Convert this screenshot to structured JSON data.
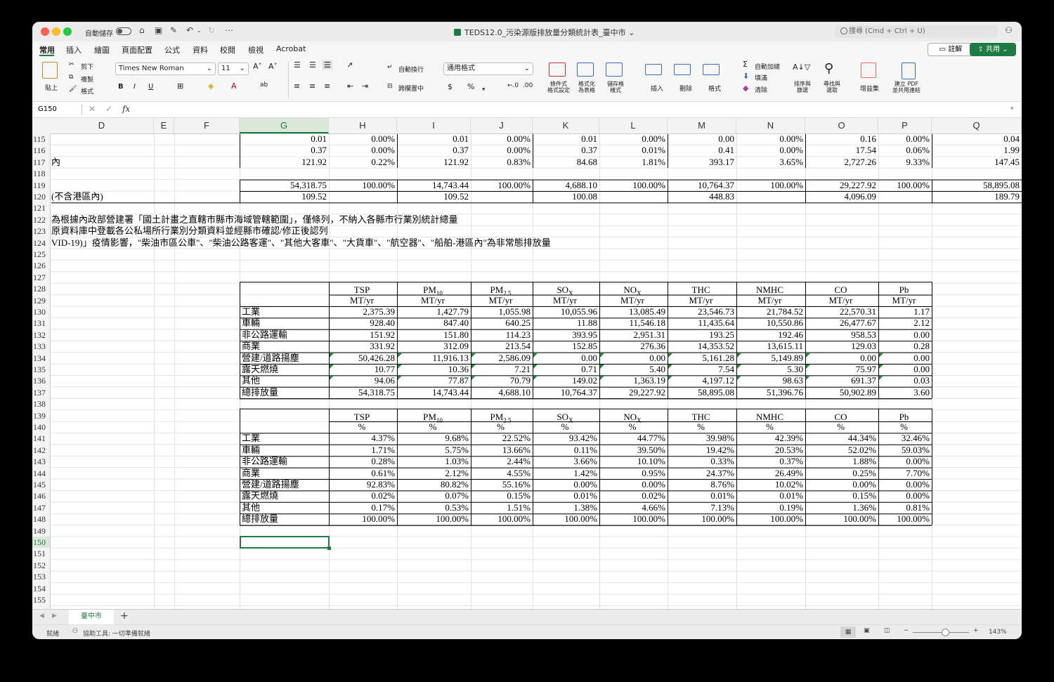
{
  "titlebar": {
    "autosave_label": "自動儲存",
    "document_title": "TEDS12.0_污染源版排放量分類統計表_臺中市 ⌄",
    "search_placeholder": "搜尋 (Cmd + Ctrl + U)"
  },
  "menu_tabs": [
    "常用",
    "插入",
    "繪圖",
    "頁面配置",
    "公式",
    "資料",
    "校閱",
    "檢視",
    "Acrobat"
  ],
  "actions": {
    "comment": "註解",
    "share": "共用"
  },
  "ribbon": {
    "paste": "貼上",
    "cut": "剪下",
    "copy": "複製",
    "format_painter": "格式",
    "font_name": "Times New Roman",
    "font_size": "11",
    "wrap_text": "自動換行",
    "merge_center": "跨欄置中",
    "number_format": "通用格式",
    "conditional_format": "條件式\n格式設定",
    "format_as_table": "格式化\n為表格",
    "cell_styles": "儲存格\n樣式",
    "insert": "插入",
    "delete": "刪除",
    "format": "格式",
    "autosum": "自動加總",
    "fill": "填滿",
    "clear": "清除",
    "sort_filter": "排序與\n篩選",
    "find_select": "尋找與\n選取",
    "addins": "增益集",
    "create_pdf": "建立 PDF\n並共用連結"
  },
  "formula_bar": {
    "name_box": "G150",
    "fx": "fx",
    "formula": ""
  },
  "columns": [
    "D",
    "E",
    "F",
    "G",
    "H",
    "I",
    "J",
    "K",
    "L",
    "M",
    "N",
    "O",
    "P",
    "Q"
  ],
  "selected_column": "G",
  "row_numbers": [
    "115",
    "116",
    "117",
    "118",
    "119",
    "120",
    "121",
    "122",
    "123",
    "124",
    "125",
    "126",
    "127",
    "128",
    "129",
    "130",
    "131",
    "132",
    "133",
    "134",
    "135",
    "136",
    "137",
    "138",
    "139",
    "140",
    "141",
    "142",
    "143",
    "144",
    "145",
    "146",
    "147",
    "148",
    "149",
    "150",
    "151",
    "152",
    "153",
    "154",
    "155"
  ],
  "selected_row": "150",
  "top_rows": [
    {
      "row": "115",
      "label": "",
      "vals": [
        "0.01",
        "0.00%",
        "0.01",
        "0.00%",
        "0.01",
        "0.00%",
        "0.00",
        "0.00%",
        "0.16",
        "0.00%",
        "0.04"
      ]
    },
    {
      "row": "116",
      "label": "",
      "vals": [
        "0.37",
        "0.00%",
        "0.37",
        "0.00%",
        "0.37",
        "0.01%",
        "0.41",
        "0.00%",
        "17.54",
        "0.06%",
        "1.99"
      ]
    },
    {
      "row": "117",
      "label": "內",
      "vals": [
        "121.92",
        "0.22%",
        "121.92",
        "0.83%",
        "84.68",
        "1.81%",
        "393.17",
        "3.65%",
        "2,727.26",
        "9.33%",
        "147.45"
      ]
    },
    {
      "row": "119",
      "label": "",
      "vals": [
        "54,318.75",
        "100.00%",
        "14,743.44",
        "100.00%",
        "4,688.10",
        "100.00%",
        "10,764.37",
        "100.00%",
        "29,227.92",
        "100.00%",
        "58,895.08"
      ]
    },
    {
      "row": "120",
      "label": "(不含港區內)",
      "vals": [
        "109.52",
        "",
        "109.52",
        "",
        "100.08",
        "",
        "448.83",
        "",
        "4,096.09",
        "",
        "189.79"
      ]
    }
  ],
  "notes": [
    "為根據內政部營建署「國土計畫之直轄市縣市海域管轄範圍」，僅條列，不納入各縣市行業別統計總量",
    "原資料庫中登載各公私場所行業別分類資料並經縣市確認/修正後認列",
    "VID-19)」疫情影響，\"柴油市區公車\"、\"柴油公路客運\"、\"其他大客車\"、\"大貨車\"、\"航空器\"、\"船舶-港區內\"為非常態排放量"
  ],
  "pollutant_headers": [
    {
      "name": "TSP",
      "sub": ""
    },
    {
      "name": "PM",
      "sub": "10"
    },
    {
      "name": "PM",
      "sub": "2.5"
    },
    {
      "name": "SO",
      "sub": "X"
    },
    {
      "name": "NO",
      "sub": "X"
    },
    {
      "name": "THC",
      "sub": ""
    },
    {
      "name": "NMHC",
      "sub": ""
    },
    {
      "name": "CO",
      "sub": ""
    },
    {
      "name": "Pb",
      "sub": ""
    }
  ],
  "table1": {
    "unit": "MT/yr",
    "rows": [
      {
        "label": "工業",
        "vals": [
          "2,375.39",
          "1,427.79",
          "1,055.98",
          "10,055.96",
          "13,085.49",
          "23,546.73",
          "21,784.52",
          "22,570.31",
          "1.17"
        ]
      },
      {
        "label": "車輛",
        "vals": [
          "928.40",
          "847.40",
          "640.25",
          "11.88",
          "11,546.18",
          "11,435.64",
          "10,550.86",
          "26,477.67",
          "2.12"
        ]
      },
      {
        "label": "非公路運輸",
        "vals": [
          "151.92",
          "151.80",
          "114.23",
          "393.95",
          "2,951.31",
          "193.25",
          "192.46",
          "958.53",
          "0.00"
        ]
      },
      {
        "label": "商業",
        "vals": [
          "331.92",
          "312.09",
          "213.54",
          "152.85",
          "276.36",
          "14,353.52",
          "13,615.11",
          "129.03",
          "0.28"
        ]
      },
      {
        "label": "營建/道路揚塵",
        "vals": [
          "50,426.28",
          "11,916.13",
          "2,586.09",
          "0.00",
          "0.00",
          "5,161.28",
          "5,149.89",
          "0.00",
          "0.00"
        ]
      },
      {
        "label": "露天燃燒",
        "vals": [
          "10.77",
          "10.36",
          "7.21",
          "0.71",
          "5.40",
          "7.54",
          "5.30",
          "75.97",
          "0.00"
        ]
      },
      {
        "label": "其他",
        "vals": [
          "94.06",
          "77.87",
          "70.79",
          "149.02",
          "1,363.19",
          "4,197.12",
          "98.63",
          "691.37",
          "0.03"
        ]
      },
      {
        "label": "總排放量",
        "vals": [
          "54,318.75",
          "14,743.44",
          "4,688.10",
          "10,764.37",
          "29,227.92",
          "58,895.08",
          "51,396.76",
          "50,902.89",
          "3.60"
        ]
      }
    ]
  },
  "table2": {
    "unit": "%",
    "rows": [
      {
        "label": "工業",
        "vals": [
          "4.37%",
          "9.68%",
          "22.52%",
          "93.42%",
          "44.77%",
          "39.98%",
          "42.39%",
          "44.34%",
          "32.46%"
        ]
      },
      {
        "label": "車輛",
        "vals": [
          "1.71%",
          "5.75%",
          "13.66%",
          "0.11%",
          "39.50%",
          "19.42%",
          "20.53%",
          "52.02%",
          "59.03%"
        ]
      },
      {
        "label": "非公路運輸",
        "vals": [
          "0.28%",
          "1.03%",
          "2.44%",
          "3.66%",
          "10.10%",
          "0.33%",
          "0.37%",
          "1.88%",
          "0.00%"
        ]
      },
      {
        "label": "商業",
        "vals": [
          "0.61%",
          "2.12%",
          "4.55%",
          "1.42%",
          "0.95%",
          "24.37%",
          "26.49%",
          "0.25%",
          "7.70%"
        ]
      },
      {
        "label": "營建/道路揚塵",
        "vals": [
          "92.83%",
          "80.82%",
          "55.16%",
          "0.00%",
          "0.00%",
          "8.76%",
          "10.02%",
          "0.00%",
          "0.00%"
        ]
      },
      {
        "label": "露天燃燒",
        "vals": [
          "0.02%",
          "0.07%",
          "0.15%",
          "0.01%",
          "0.02%",
          "0.01%",
          "0.01%",
          "0.15%",
          "0.00%"
        ]
      },
      {
        "label": "其他",
        "vals": [
          "0.17%",
          "0.53%",
          "1.51%",
          "1.38%",
          "4.66%",
          "7.13%",
          "0.19%",
          "1.36%",
          "0.81%"
        ]
      },
      {
        "label": "總排放量",
        "vals": [
          "100.00%",
          "100.00%",
          "100.00%",
          "100.00%",
          "100.00%",
          "100.00%",
          "100.00%",
          "100.00%",
          "100.00%"
        ]
      }
    ]
  },
  "sheet_tab": "臺中市",
  "status": {
    "ready": "就緒",
    "accessibility": "協助工具: 一切準備就緒",
    "zoom": "143%"
  }
}
